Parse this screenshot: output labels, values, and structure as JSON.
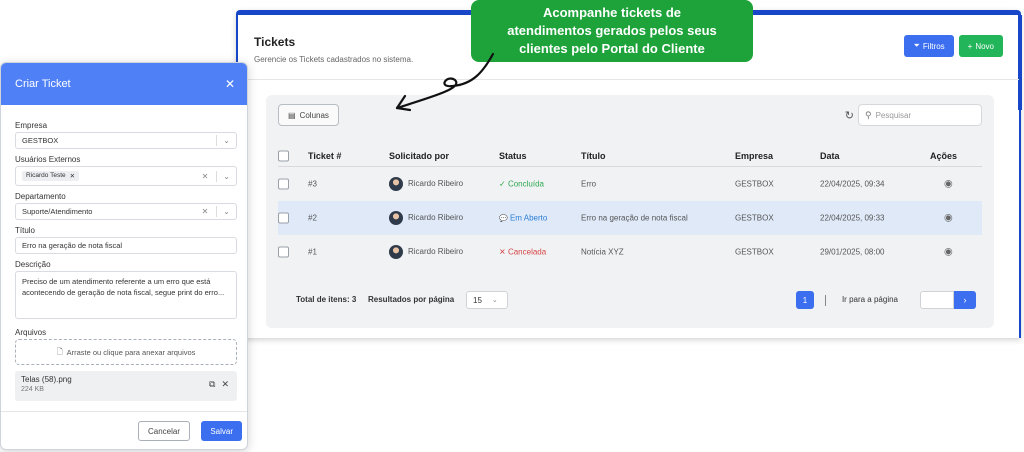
{
  "callout": {
    "line1": "Acompanhe tickets de",
    "line2": "atendimentos gerados pelos seus",
    "line3": "clientes pelo Portal do Cliente"
  },
  "main": {
    "title": "Tickets",
    "subtitle": "Gerencie os Tickets cadastrados no sistema.",
    "filters_label": "Filtros",
    "new_label": "Novo",
    "columns_label": "Colunas",
    "search_placeholder": "Pesquisar",
    "table": {
      "headers": [
        "Ticket #",
        "Solicitado por",
        "Status",
        "Título",
        "Empresa",
        "Data",
        "Ações"
      ],
      "rows": [
        {
          "ticket": "#3",
          "requester": "Ricardo Ribeiro",
          "status": "Concluída",
          "status_icon": "✓",
          "title": "Erro",
          "company": "GESTBOX",
          "date": "22/04/2025, 09:34"
        },
        {
          "ticket": "#2",
          "requester": "Ricardo Ribeiro",
          "status": "Em Aberto",
          "status_icon": "💬",
          "title": "Erro na geração de nota fiscal",
          "company": "GESTBOX",
          "date": "22/04/2025, 09:33"
        },
        {
          "ticket": "#1",
          "requester": "Ricardo Ribeiro",
          "status": "Cancelada",
          "status_icon": "✕",
          "title": "Notícia XYZ",
          "company": "GESTBOX",
          "date": "29/01/2025, 08:00"
        }
      ]
    },
    "footer": {
      "total_label": "Total de itens: 3",
      "per_page_label": "Resultados por página",
      "per_page_value": "15",
      "current_page": "1",
      "goto_label": "Ir para a página"
    }
  },
  "modal": {
    "title": "Criar Ticket",
    "company_label": "Empresa",
    "company_value": "GESTBOX",
    "users_label": "Usuários Externos",
    "users_tag": "Ricardo Teste",
    "department_label": "Departamento",
    "department_value": "Suporte/Atendimento",
    "title_label": "Título",
    "title_value": "Erro na geração de nota fiscal",
    "description_label": "Descrição",
    "description_value": "Preciso de um atendimento referente a um erro que está acontecendo de geração de nota fiscal, segue print do erro...",
    "files_label": "Arquivos",
    "dropzone_label": "Arraste ou clique para anexar arquivos",
    "file_name": "Telas (58).png",
    "file_size": "224 KB",
    "cancel_label": "Cancelar",
    "save_label": "Salvar"
  },
  "colors": {
    "primary": "#3b6ff0",
    "green": "#22b55a",
    "callout": "#1ea33a",
    "header_blue": "#4f80f6"
  }
}
